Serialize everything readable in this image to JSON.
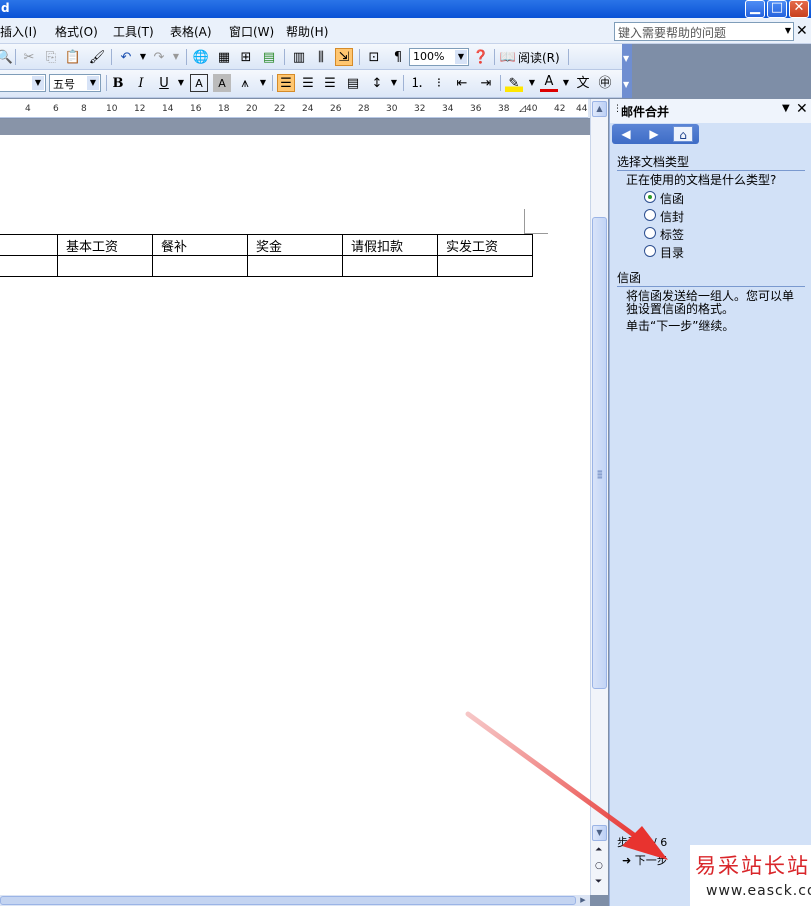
{
  "window": {
    "title_fragment": "d"
  },
  "menu": {
    "items": [
      "插入(I)",
      "格式(O)",
      "工具(T)",
      "表格(A)",
      "窗口(W)",
      "帮助(H)"
    ],
    "help_placeholder": "键入需要帮助的问题"
  },
  "toolbar": {
    "zoom": "100%",
    "read_label": "阅读(R)",
    "font_size": "五号"
  },
  "ruler": {
    "ticks": [
      "4",
      "6",
      "8",
      "10",
      "12",
      "14",
      "16",
      "18",
      "20",
      "22",
      "24",
      "26",
      "28",
      "30",
      "32",
      "34",
      "36",
      "38",
      "40",
      "42",
      "44"
    ]
  },
  "document": {
    "table_headers": [
      "",
      "基本工资",
      "餐补",
      "奖金",
      "请假扣款",
      "实发工资"
    ]
  },
  "task_pane": {
    "title": "邮件合并",
    "section1_heading": "选择文档类型",
    "question": "正在使用的文档是什么类型?",
    "options": [
      {
        "label": "信函",
        "selected": true
      },
      {
        "label": "信封",
        "selected": false
      },
      {
        "label": "标签",
        "selected": false
      },
      {
        "label": "目录",
        "selected": false
      }
    ],
    "section2_heading": "信函",
    "desc_line1": "将信函发送给一组人。您可以单",
    "desc_line2": "独设置信函的格式。",
    "instruction": "单击“下一步”继续。",
    "step_text": "步骤 1 / 6",
    "next_link": "下一步"
  },
  "watermark": {
    "cn": "易采站长站",
    "url": "www.easck.com"
  },
  "colors": {
    "arrow": "#e8332f",
    "titlebar": "#0a52d6",
    "pane_bg": "#d2e1f7"
  }
}
